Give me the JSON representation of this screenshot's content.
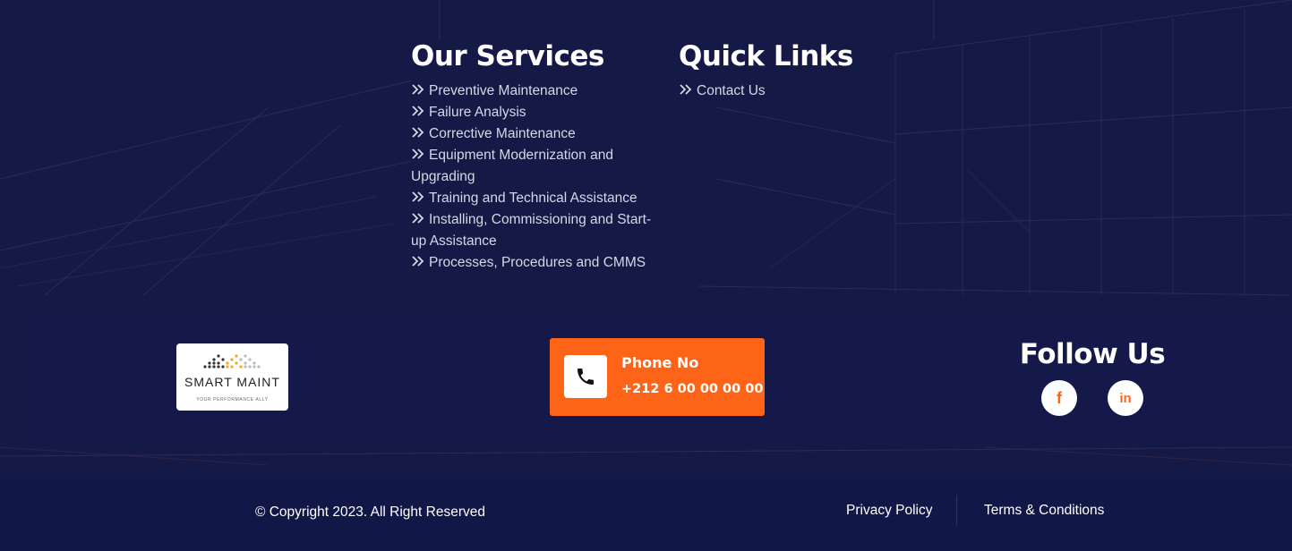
{
  "services": {
    "title": "Our Services",
    "items": [
      {
        "label": "Preventive Maintenance"
      },
      {
        "label": "Failure Analysis"
      },
      {
        "label": "Corrective Maintenance"
      },
      {
        "label": "Equipment Modernization and Upgrading"
      },
      {
        "label": "Training and Technical Assistance"
      },
      {
        "label": "Installing, Commissioning and Start-up Assistance"
      },
      {
        "label": "Processes, Procedures and CMMS"
      }
    ]
  },
  "quick_links": {
    "title": "Quick Links",
    "items": [
      {
        "label": "Contact Us"
      }
    ]
  },
  "logo": {
    "name": "SMART MAINT",
    "tagline": "YOUR PERFORMANCE ALLY"
  },
  "contact": {
    "label": "Phone No",
    "phone": "+212 6 00 00 00 00",
    "icon": "phone-icon"
  },
  "follow": {
    "title": "Follow Us",
    "socials": [
      {
        "icon": "facebook-icon",
        "glyph": "f"
      },
      {
        "icon": "linkedin-icon",
        "glyph": "in"
      }
    ]
  },
  "footer": {
    "copyright": "© Copyright 2023. All Right Reserved",
    "links": [
      {
        "label": "Privacy Policy"
      },
      {
        "label": "Terms & Conditions"
      }
    ]
  },
  "colors": {
    "background": "#151a46",
    "accent": "#fe6418",
    "band": "#15194a",
    "bottom_bar": "#111747"
  }
}
